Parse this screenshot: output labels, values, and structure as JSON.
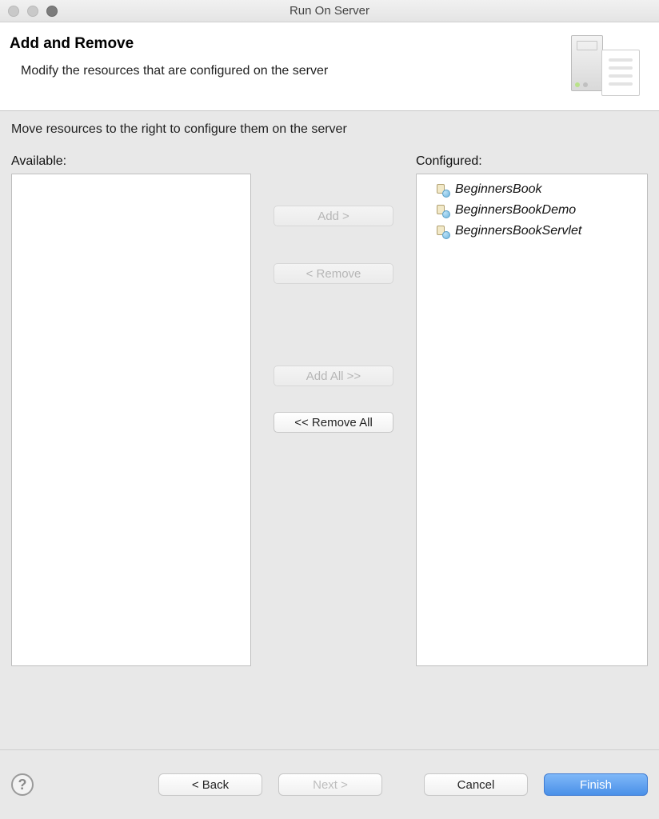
{
  "window": {
    "title": "Run On Server"
  },
  "header": {
    "heading": "Add and Remove",
    "subheading": "Modify the resources that are configured on the server"
  },
  "body": {
    "instruction": "Move resources to the right to configure them on the server",
    "available_label": "Available:",
    "configured_label": "Configured:",
    "available_items": [],
    "configured_items": [
      {
        "name": "BeginnersBook"
      },
      {
        "name": "BeginnersBookDemo"
      },
      {
        "name": "BeginnersBookServlet"
      }
    ],
    "buttons": {
      "add": "Add >",
      "remove": "< Remove",
      "add_all": "Add All >>",
      "remove_all": "<< Remove All"
    },
    "button_state": {
      "add": "disabled",
      "remove": "disabled",
      "add_all": "disabled",
      "remove_all": "enabled"
    }
  },
  "footer": {
    "back": "< Back",
    "next": "Next >",
    "cancel": "Cancel",
    "finish": "Finish",
    "next_enabled": false
  }
}
